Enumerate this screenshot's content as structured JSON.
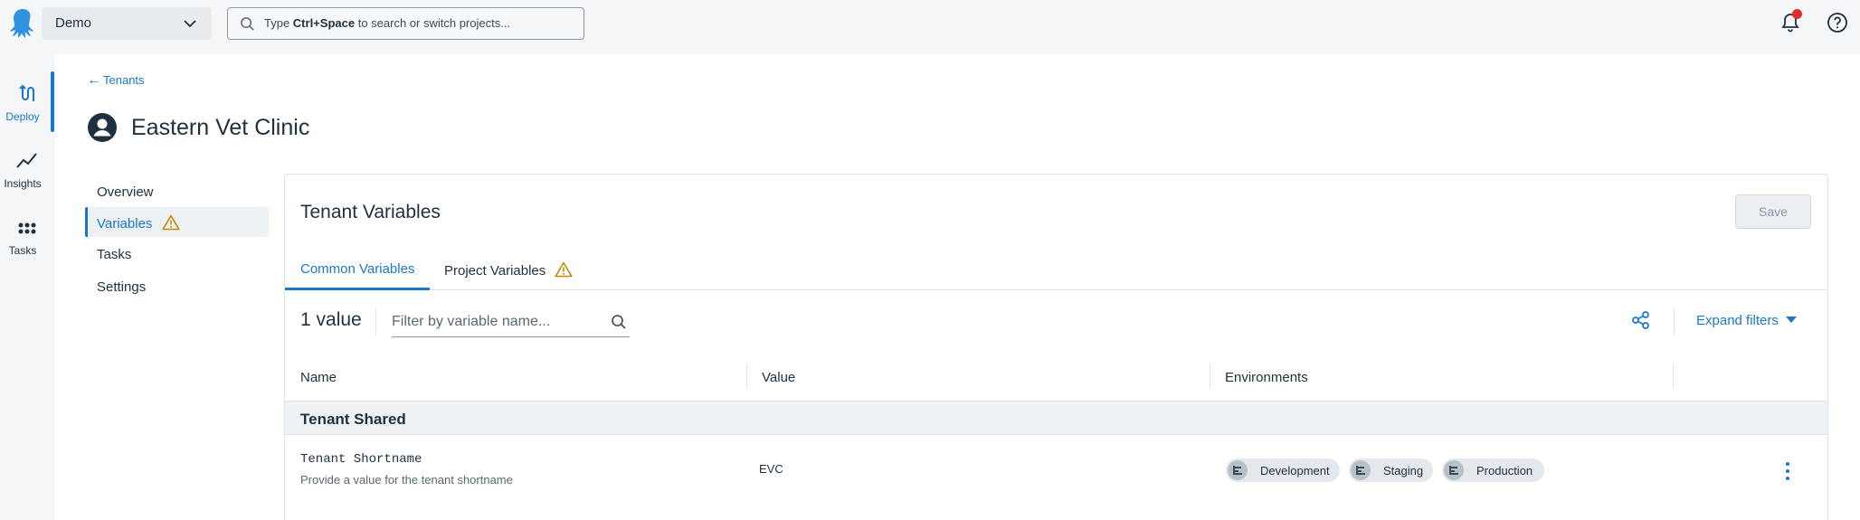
{
  "topbar": {
    "space_name": "Demo",
    "search_prefix": "Type ",
    "search_shortcut": "Ctrl+Space",
    "search_suffix": " to search or switch projects..."
  },
  "rail": {
    "items": [
      {
        "label": "Deploy",
        "icon": "deploy-icon"
      },
      {
        "label": "Insights",
        "icon": "insights-icon"
      },
      {
        "label": "Tasks",
        "icon": "tasks-icon"
      }
    ]
  },
  "breadcrumb": {
    "back_label": "Tenants"
  },
  "page": {
    "title": "Eastern Vet Clinic"
  },
  "sidenav": {
    "items": [
      {
        "label": "Overview"
      },
      {
        "label": "Variables"
      },
      {
        "label": "Tasks"
      },
      {
        "label": "Settings"
      }
    ]
  },
  "card": {
    "title": "Tenant Variables",
    "save_label": "Save",
    "tabs": [
      {
        "label": "Common Variables"
      },
      {
        "label": "Project Variables"
      }
    ],
    "count_label": "1 value",
    "filter_placeholder": "Filter by variable name...",
    "expand_label": "Expand filters"
  },
  "table": {
    "columns": [
      "Name",
      "Value",
      "Environments"
    ],
    "group_name": "Tenant Shared",
    "rows": [
      {
        "name": "Tenant Shortname",
        "help": "Provide a value for the tenant shortname",
        "value": "EVC",
        "environments": [
          "Development",
          "Staging",
          "Production"
        ]
      }
    ]
  },
  "colors": {
    "accent": "#1a77ca",
    "warning": "#c08a00",
    "notification": "#e22b2b"
  }
}
